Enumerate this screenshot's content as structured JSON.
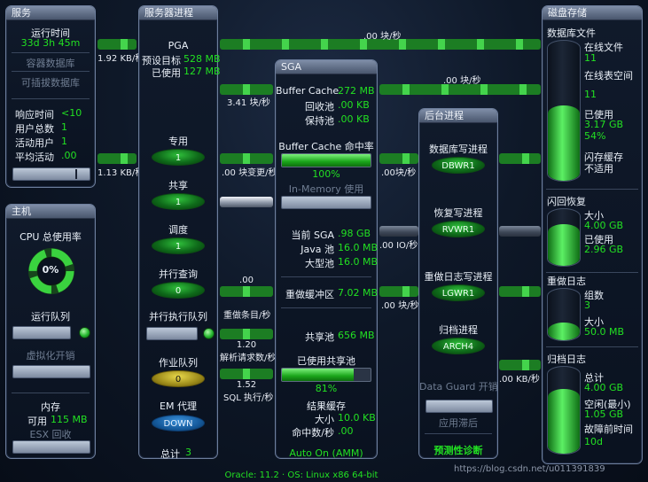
{
  "service": {
    "title": "服务",
    "uptime_label": "运行时间",
    "uptime_value": "33d 3h 45m",
    "container_db": "容器数据库",
    "pluggable_db": "可插拔数据库",
    "response_time_label": "响应时间",
    "response_time_value": "<10",
    "user_count_label": "用户总数",
    "user_count_value": "1",
    "active_users_label": "活动用户",
    "active_users_value": "1",
    "avg_active_label": "平均活动",
    "avg_active_value": ".00"
  },
  "host": {
    "title": "主机",
    "cpu_label": "CPU 总使用率",
    "cpu_value": "0%",
    "run_queue_label": "运行队列",
    "virtualization_label": "虚拟化开销",
    "memory_label": "内存",
    "available_label": "可用",
    "available_value": "115 MB",
    "esx_label": "ESX 回收"
  },
  "server_processes": {
    "title": "服务器进程",
    "pga_label": "PGA",
    "target_label": "预设目标",
    "target_value": "528 MB",
    "used_label": "已使用",
    "used_value": "127 MB",
    "dedicated_label": "专用",
    "dedicated_value": "1",
    "shared_label": "共享",
    "shared_value": "1",
    "dispatcher_label": "调度",
    "dispatcher_value": "1",
    "parallel_query_label": "并行查询",
    "parallel_query_value": "0",
    "parallel_exec_queue_label": "并行执行队列",
    "job_queue_label": "作业队列",
    "job_queue_value": "0",
    "em_agent_label": "EM 代理",
    "em_agent_value": "DOWN",
    "total_label": "总计",
    "total_value": "3"
  },
  "sga": {
    "title": "SGA",
    "buffer_cache_label": "Buffer Cache",
    "buffer_cache_value": "272 MB",
    "recycle_label": "回收池",
    "recycle_value": ".00 KB",
    "keep_label": "保持池",
    "keep_value": ".00 KB",
    "hit_rate_label": "Buffer Cache 命中率",
    "hit_rate_value": "100%",
    "hit_rate_fraction": 1.0,
    "inmemory_label": "In-Memory 使用",
    "current_sga_label": "当前 SGA",
    "current_sga_value": ".98 GB",
    "java_pool_label": "Java 池",
    "java_pool_value": "16.0 MB",
    "large_pool_label": "大型池",
    "large_pool_value": "16.0 MB",
    "redo_buffer_label": "重做缓冲区",
    "redo_buffer_value": "7.02 MB",
    "shared_pool_label": "共享池",
    "shared_pool_value": "656 MB",
    "shared_pool_used_label": "已使用共享池",
    "shared_pool_used_value": "81%",
    "shared_pool_used_fraction": 0.81,
    "result_cache_label": "结果缓存",
    "result_size_label": "大小",
    "result_size_value": "10.0 KB",
    "result_hits_label": "命中数/秒",
    "result_hits_value": ".00",
    "auto_label": "Auto On (AMM)"
  },
  "background": {
    "title": "后台进程",
    "dbwr_label": "数据库写进程",
    "dbwr_value": "DBWR1",
    "rvwr_label": "恢复写进程",
    "rvwr_value": "RVWR1",
    "lgwr_label": "重做日志写进程",
    "lgwr_value": "LGWR1",
    "arch_label": "归档进程",
    "arch_value": "ARCH4",
    "dataguard_label": "Data Guard 开销",
    "apply_lag_label": "应用滞后",
    "predictive_label": "预测性诊断"
  },
  "disk": {
    "title": "磁盘存储",
    "datafile_label": "数据库文件",
    "online_files_label": "在线文件",
    "online_files_value": "11",
    "online_space_label": "在线表空间",
    "online_space_value": "11",
    "datafile_used_label": "已使用",
    "datafile_used_value": "3.17 GB",
    "datafile_used_pct": "54%",
    "datafile_used_fraction": 0.54,
    "flash_cache_label": "闪存缓存",
    "flash_cache_value": "不适用",
    "flashback_label": "闪回恢复",
    "flashback_size_label": "大小",
    "flashback_size_value": "4.00 GB",
    "flashback_used_label": "已使用",
    "flashback_used_value": "2.96 GB",
    "flashback_fraction": 0.74,
    "redo_log_label": "重做日志",
    "redo_groups_label": "组数",
    "redo_groups_value": "3",
    "redo_size_label": "大小",
    "redo_size_value": "50.0 MB",
    "redo_fraction": 0.35,
    "archive_label": "归档日志",
    "archive_total_label": "总计",
    "archive_total_value": "4.00 GB",
    "archive_free_label": "空闲(最小)",
    "archive_free_value": "1.05 GB",
    "archive_time_label": "故障前时间",
    "archive_time_value": "10d",
    "archive_fraction": 0.74
  },
  "flows": {
    "svc_mb_1": "1.92 KB/秒",
    "svc_mb_2": "1.13 KB/秒",
    "top_rate": ".00 块/秒",
    "top_rate_2": ".00 块/秒",
    "blocks_read": "3.41 块/秒",
    "block_changes": ".00 块变更/秒",
    "sga_out": ".00块/秒",
    "io_rate": ".00 IO/秒",
    "redo_entries_val": ".00",
    "redo_entries_label": "重做条目/秒",
    "redo_out": ".00 块/秒",
    "parse_val": "1.20",
    "parse_label": "解析请求数/秒",
    "sql_val": "1.52",
    "sql_label": "SQL 执行/秒",
    "arch_rate": ".00 KB/秒"
  },
  "footer": {
    "os_text": "Oracle: 11.2 · OS: Linux x86 64-bit",
    "watermark": "https://blog.csdn.net/u011391839"
  }
}
